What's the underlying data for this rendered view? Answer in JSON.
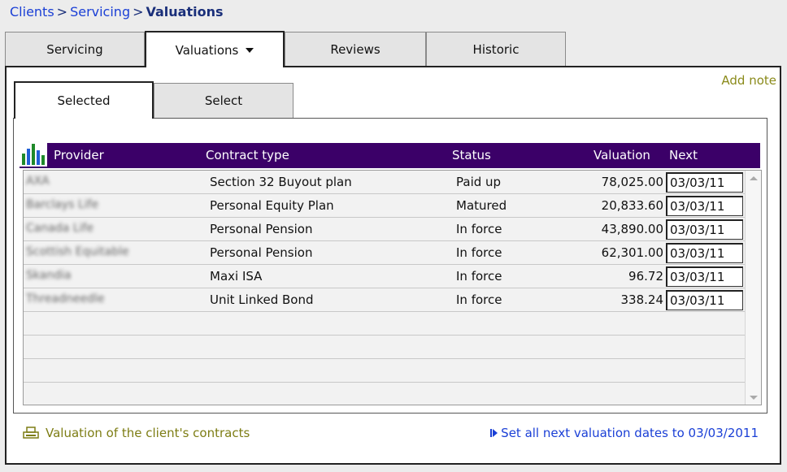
{
  "breadcrumb": {
    "crumbs": [
      "Clients",
      "Servicing"
    ],
    "separator": ">",
    "current": "Valuations"
  },
  "tabs": [
    {
      "label": "Servicing",
      "active": false
    },
    {
      "label": "Valuations",
      "active": true,
      "has_dropdown": true
    },
    {
      "label": "Reviews",
      "active": false
    },
    {
      "label": "Historic",
      "active": false
    }
  ],
  "add_note": "Add note",
  "inner_tabs": [
    {
      "label": "Selected",
      "active": true
    },
    {
      "label": "Select",
      "active": false
    }
  ],
  "grid": {
    "icon": "bar-chart-icon",
    "columns": [
      "Provider",
      "Contract type",
      "Status",
      "Valuation",
      "Next"
    ],
    "rows": [
      {
        "provider": "AXA",
        "contract_type": "Section 32 Buyout plan",
        "status": "Paid up",
        "valuation": "78,025.00",
        "next": "03/03/11"
      },
      {
        "provider": "Barclays Life",
        "contract_type": "Personal Equity Plan",
        "status": "Matured",
        "valuation": "20,833.60",
        "next": "03/03/11"
      },
      {
        "provider": "Canada Life",
        "contract_type": "Personal Pension",
        "status": "In force",
        "valuation": "43,890.00",
        "next": "03/03/11"
      },
      {
        "provider": "Scottish Equitable",
        "contract_type": "Personal Pension",
        "status": "In force",
        "valuation": "62,301.00",
        "next": "03/03/11"
      },
      {
        "provider": "Skandia",
        "contract_type": "Maxi ISA",
        "status": "In force",
        "valuation": "96.72",
        "next": "03/03/11"
      },
      {
        "provider": "Threadneedle",
        "contract_type": "Unit Linked Bond",
        "status": "In force",
        "valuation": "338.24",
        "next": "03/03/11"
      }
    ]
  },
  "footer": {
    "left_icon": "printer-icon",
    "left_label": "Valuation of the client's contracts",
    "right_icon": "skip-arrow-icon",
    "right_label": "Set all next valuation dates to 03/03/2011"
  },
  "colors": {
    "header_bg": "#3b0068",
    "link_blue": "#1a3fd6",
    "olive": "#7d7d14",
    "breadcrumb_current": "#1a2f7a"
  }
}
